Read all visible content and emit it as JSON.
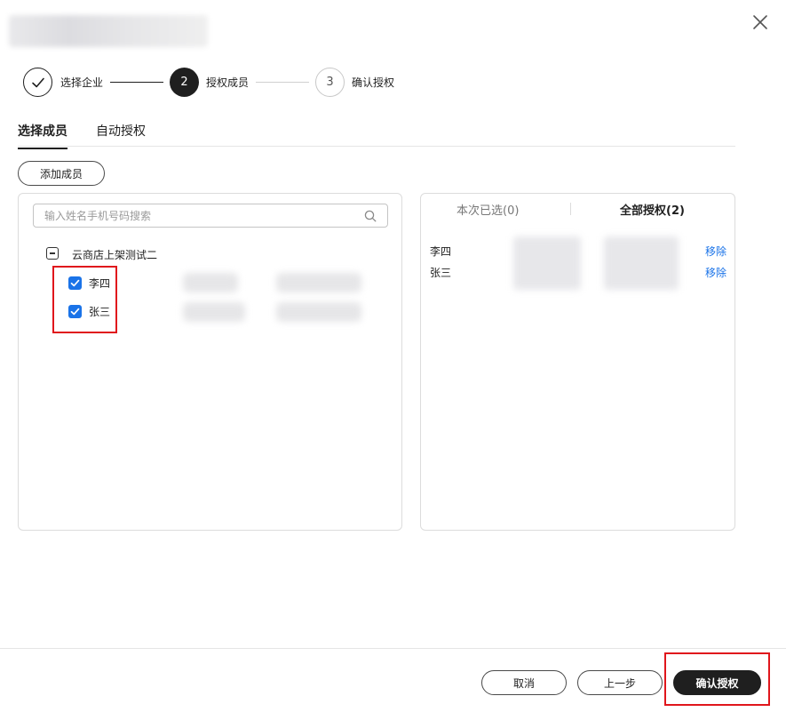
{
  "dialog": {
    "close_icon": "close-icon"
  },
  "steps": [
    {
      "number": "",
      "label": "选择企业",
      "state": "done"
    },
    {
      "number": "2",
      "label": "授权成员",
      "state": "active"
    },
    {
      "number": "3",
      "label": "确认授权",
      "state": "todo"
    }
  ],
  "tabs": [
    {
      "label": "选择成员",
      "active": true
    },
    {
      "label": "自动授权",
      "active": false
    }
  ],
  "add_member_label": "添加成员",
  "search": {
    "placeholder": "输入姓名手机号码搜索",
    "icon": "search-icon"
  },
  "tree": {
    "parent_label": "云商店上架测试二",
    "members": [
      {
        "name": "李四",
        "checked": true
      },
      {
        "name": "张三",
        "checked": true
      }
    ]
  },
  "right_panel": {
    "tab_selected": "本次已选(0)",
    "tab_all": "全部授权(2)",
    "authorized": [
      {
        "name": "李四",
        "action": "移除"
      },
      {
        "name": "张三",
        "action": "移除"
      }
    ]
  },
  "footer": {
    "cancel_label": "取消",
    "prev_label": "上一步",
    "confirm_label": "确认授权"
  },
  "colors": {
    "accent": "#1a73e8",
    "dark": "#1f1f1f",
    "highlight": "#e0161c"
  }
}
